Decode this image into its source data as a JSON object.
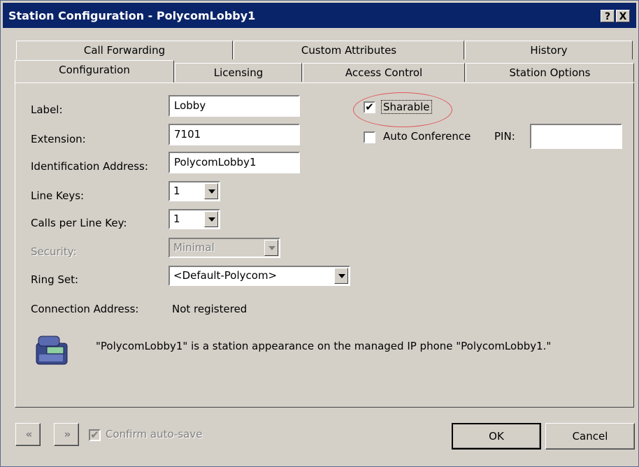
{
  "window": {
    "title": "Station Configuration - PolycomLobby1",
    "help_button": "?",
    "close_button": "X"
  },
  "tabs": {
    "row1": [
      "Call Forwarding",
      "Custom Attributes",
      "History"
    ],
    "row2": [
      "Configuration",
      "Licensing",
      "Access Control",
      "Station Options"
    ],
    "active": "Configuration"
  },
  "form": {
    "label": {
      "label": "Label:",
      "value": "Lobby"
    },
    "extension": {
      "label": "Extension:",
      "value": "7101"
    },
    "identification_address": {
      "label": "Identification Address:",
      "value": "PolycomLobby1"
    },
    "line_keys": {
      "label": "Line Keys:",
      "value": "1"
    },
    "calls_per_line_key": {
      "label": "Calls per Line Key:",
      "value": "1"
    },
    "security": {
      "label": "Security:",
      "value": "Minimal",
      "disabled": true
    },
    "ring_set": {
      "label": "Ring Set:",
      "value": "<Default-Polycom>"
    },
    "connection_address": {
      "label": "Connection Address:",
      "value": "Not registered"
    },
    "sharable": {
      "label": "Sharable",
      "checked": true
    },
    "auto_conference": {
      "label": "Auto Conference",
      "checked": false
    },
    "pin": {
      "label": "PIN:",
      "value": ""
    }
  },
  "info_message": "\"PolycomLobby1\" is a station appearance on the managed IP phone \"PolycomLobby1.\"",
  "footer": {
    "confirm_auto_save": "Confirm auto-save",
    "ok": "OK",
    "cancel": "Cancel"
  },
  "icons": {
    "phone": "phone-icon",
    "prev": "double-chevron-left-icon",
    "next": "double-chevron-right-icon"
  },
  "colors": {
    "titlebar": "#0a246a",
    "highlight_circle": "#e05a5a"
  }
}
